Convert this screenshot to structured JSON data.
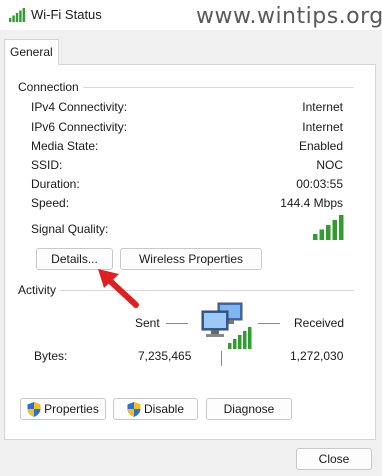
{
  "window": {
    "title": "Wi-Fi Status"
  },
  "watermark": "www.wintips.org",
  "tabs": [
    {
      "label": "General"
    }
  ],
  "connection": {
    "group_label": "Connection",
    "rows": [
      {
        "label": "IPv4 Connectivity:",
        "value": "Internet"
      },
      {
        "label": "IPv6 Connectivity:",
        "value": "Internet"
      },
      {
        "label": "Media State:",
        "value": "Enabled"
      },
      {
        "label": "SSID:",
        "value": "NOC"
      },
      {
        "label": "Duration:",
        "value": "00:03:55"
      },
      {
        "label": "Speed:",
        "value": "144.4 Mbps"
      }
    ],
    "signal_label": "Signal Quality:",
    "signal_bars": 5,
    "buttons": {
      "details": "Details...",
      "wireless": "Wireless Properties"
    }
  },
  "activity": {
    "group_label": "Activity",
    "sent_label": "Sent",
    "received_label": "Received",
    "bytes_label": "Bytes:",
    "bytes_sent": "7,235,465",
    "bytes_received": "1,272,030"
  },
  "action_buttons": {
    "properties": "Properties",
    "disable": "Disable",
    "diagnose": "Diagnose"
  },
  "footer": {
    "close": "Close"
  },
  "colors": {
    "signal_green": "#2e9e2e",
    "arrow_red": "#e02020",
    "shield_blue": "#2a6fd6",
    "shield_yellow": "#f2c21b"
  },
  "icons": [
    "wifi-signal-icon",
    "network-computers-icon",
    "shield-icon",
    "red-arrow-annotation"
  ]
}
